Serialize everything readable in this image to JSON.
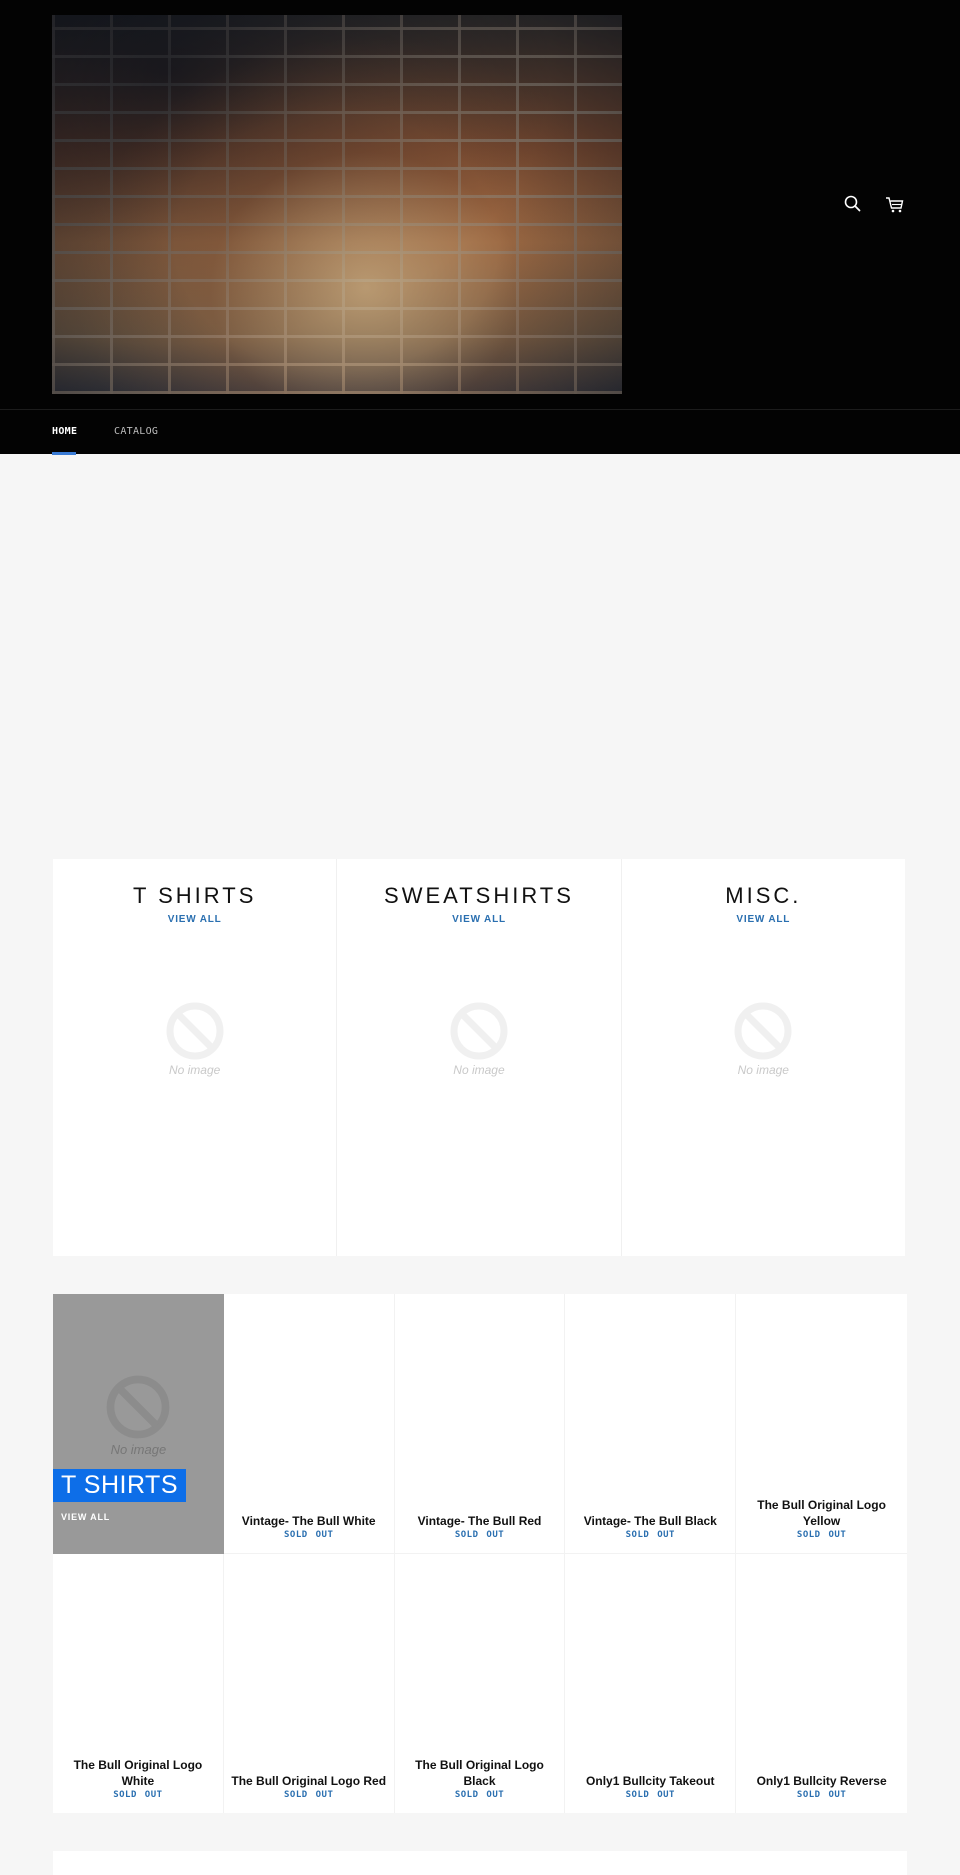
{
  "header": {
    "hero_image": "brick-wall-image",
    "icons": {
      "search": "search-icon",
      "cart": "cart-icon"
    }
  },
  "nav": {
    "items": [
      {
        "label": "HOME",
        "active": true
      },
      {
        "label": "CATALOG",
        "active": false
      }
    ],
    "accent_color": "#3a7bd5"
  },
  "collections": [
    {
      "title": "T SHIRTS",
      "link": "VIEW ALL",
      "placeholder": "No image"
    },
    {
      "title": "SWEATSHIRTS",
      "link": "VIEW ALL",
      "placeholder": "No image"
    },
    {
      "title": "MISC.",
      "link": "VIEW ALL",
      "placeholder": "No image"
    }
  ],
  "featured_collection": {
    "title": "T SHIRTS",
    "link": "VIEW ALL",
    "placeholder": "No image",
    "label_color": "#0d6ee8"
  },
  "products": [
    {
      "title": "Vintage- The Bull White",
      "status": "SOLD OUT"
    },
    {
      "title": "Vintage- The Bull Red",
      "status": "SOLD OUT"
    },
    {
      "title": "Vintage- The Bull Black",
      "status": "SOLD OUT"
    },
    {
      "title": "The Bull Original Logo Yellow",
      "status": "SOLD OUT"
    },
    {
      "title": "The Bull Original Logo White",
      "status": "SOLD OUT"
    },
    {
      "title": "The Bull Original Logo Red",
      "status": "SOLD OUT"
    },
    {
      "title": "The Bull Original Logo Black",
      "status": "SOLD OUT"
    },
    {
      "title": "Only1 Bullcity Takeout",
      "status": "SOLD OUT"
    },
    {
      "title": "Only1 Bullcity Reverse",
      "status": "SOLD OUT"
    }
  ],
  "colors": {
    "link_blue": "#2a6fb0",
    "page_bg": "#f6f6f6",
    "header_bg": "#030303"
  }
}
